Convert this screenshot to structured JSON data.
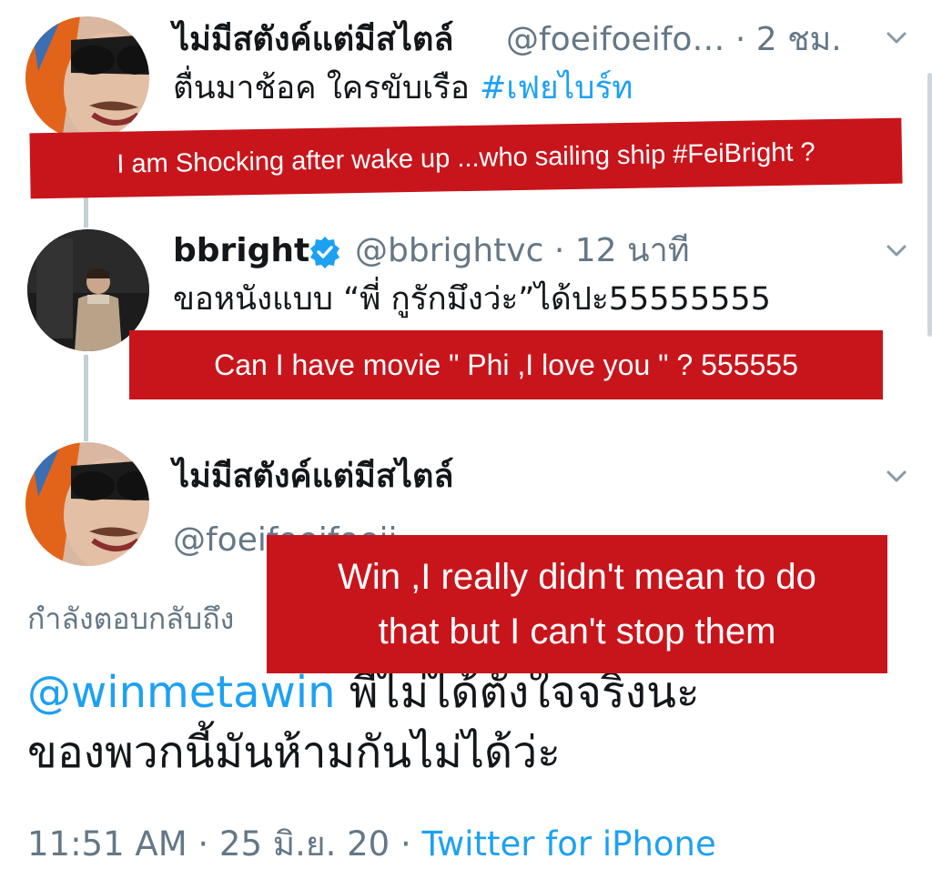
{
  "tweet1": {
    "name": "ไม่มีสตังค์แต่มีสไตล์",
    "handle": "@foeifoeifo…",
    "separator": "·",
    "time": "2 ชม.",
    "text": "ตื่นมาช้อค ใครขับเรือ ",
    "hashtag": "#เฟยไบร์ท",
    "translation": "I am Shocking after wake up ...who sailing ship #FeiBright  ?"
  },
  "tweet2": {
    "name": "bbright",
    "handle": "@bbrightvc",
    "separator": "·",
    "time": "12 นาที",
    "text": "ขอหนังแบบ “พี่ กูรักมึงว่ะ”ได้ปะ55555555",
    "translation": "Can I have movie \" Phi ,I love you \" ? 555555"
  },
  "tweet3": {
    "name": "ไม่มีสตังค์แต่มีสไตล์",
    "handle": "@foeifoeifoeii",
    "replying_to": "กำลังตอบกลับถึง",
    "mention": "@winmetawin",
    "text_line1": "  พี่ไม่ได้ตั้งใจจริงนะ",
    "text_line2": "ของพวกนี้มันห้ามกันไม่ได้ว่ะ",
    "translation_line1": "Win  ,I really didn't mean to do",
    "translation_line2": "that  but I can't stop them",
    "timestamp": "11:51 AM · 25 มิ.ย. 20 · ",
    "source": "Twitter for iPhone"
  },
  "icons": {
    "chevron": "chevron-down-icon",
    "verified": "verified-badge-icon"
  },
  "colors": {
    "link_blue": "#1da1f2",
    "muted_gray": "#657786",
    "banner_red": "#c8151c",
    "thread_line": "#c4cfd6"
  }
}
